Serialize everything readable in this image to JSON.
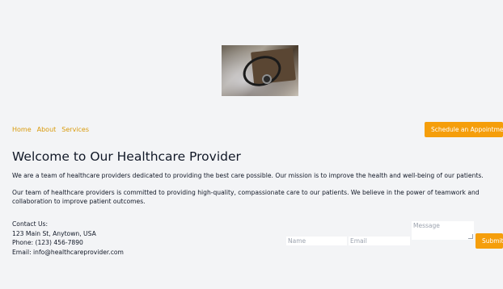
{
  "hero": {
    "image": "stethoscope-photo"
  },
  "nav": {
    "items": [
      "Home",
      "About",
      "Services"
    ]
  },
  "cta": {
    "label": "Schedule an Appointment"
  },
  "main": {
    "title": "Welcome to Our Healthcare Provider",
    "paragraphs": [
      "We are a team of healthcare providers dedicated to providing the best care possible. Our mission is to improve the health and well-being of our patients.",
      "Our team of healthcare providers is committed to providing high-quality, compassionate care to our patients. We believe in the power of teamwork and collaboration to improve patient outcomes."
    ]
  },
  "contact": {
    "heading": "Contact Us:",
    "address": "123 Main St, Anytown, USA",
    "phone": "Phone: (123) 456-7890",
    "email": "Email: info@healthcareprovider.com"
  },
  "form": {
    "name_placeholder": "Name",
    "email_placeholder": "Email",
    "message_placeholder": "Message",
    "submit_label": "Submit"
  },
  "colors": {
    "accent": "#f59e0b",
    "link": "#d99a0b",
    "background": "#f3f4f6"
  }
}
